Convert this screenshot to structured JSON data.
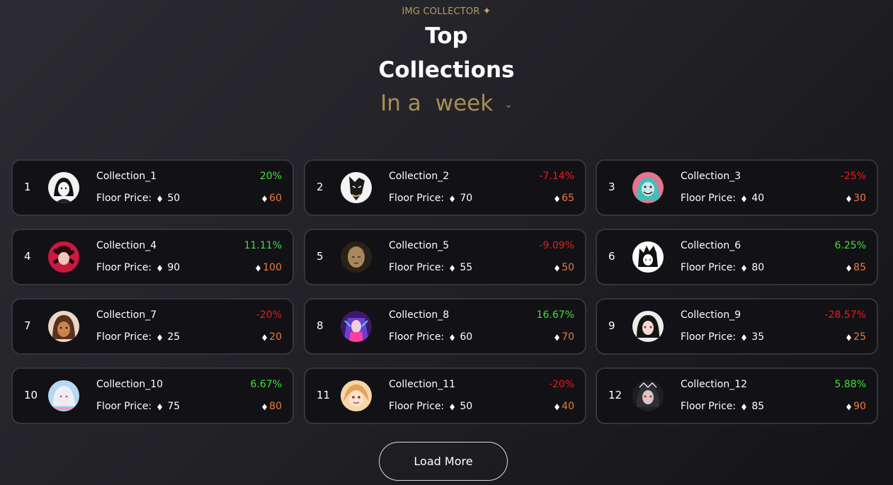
{
  "header": {
    "eyebrow": "IMG COLLECTOR",
    "eyebrow_icon": "sparkle-icon",
    "title_line1": "Top",
    "title_line2": "Collections",
    "period_prefix": "In a",
    "period_value": "week",
    "period_icon": "chevron-down-icon"
  },
  "labels": {
    "floor_price": "Floor Price:"
  },
  "colors": {
    "accent_gold": "#a88f56",
    "positive": "#3ee03a",
    "negative": "#ee1a1a",
    "current_price": "#f07a3c"
  },
  "collections": [
    {
      "rank": "1",
      "name": "Collection_1",
      "change": "20%",
      "direction": "up",
      "floor": "50",
      "current": "60"
    },
    {
      "rank": "2",
      "name": "Collection_2",
      "change": "-7.14%",
      "direction": "down",
      "floor": "70",
      "current": "65"
    },
    {
      "rank": "3",
      "name": "Collection_3",
      "change": "-25%",
      "direction": "down",
      "floor": "40",
      "current": "30"
    },
    {
      "rank": "4",
      "name": "Collection_4",
      "change": "11.11%",
      "direction": "up",
      "floor": "90",
      "current": "100"
    },
    {
      "rank": "5",
      "name": "Collection_5",
      "change": "-9.09%",
      "direction": "down",
      "floor": "55",
      "current": "50"
    },
    {
      "rank": "6",
      "name": "Collection_6",
      "change": "6.25%",
      "direction": "up",
      "floor": "80",
      "current": "85"
    },
    {
      "rank": "7",
      "name": "Collection_7",
      "change": "-20%",
      "direction": "down",
      "floor": "25",
      "current": "20"
    },
    {
      "rank": "8",
      "name": "Collection_8",
      "change": "16.67%",
      "direction": "up",
      "floor": "60",
      "current": "70"
    },
    {
      "rank": "9",
      "name": "Collection_9",
      "change": "-28.57%",
      "direction": "down",
      "floor": "35",
      "current": "25"
    },
    {
      "rank": "10",
      "name": "Collection_10",
      "change": "6.67%",
      "direction": "up",
      "floor": "75",
      "current": "80"
    },
    {
      "rank": "11",
      "name": "Collection_11",
      "change": "-20%",
      "direction": "down",
      "floor": "50",
      "current": "40"
    },
    {
      "rank": "12",
      "name": "Collection_12",
      "change": "5.88%",
      "direction": "up",
      "floor": "85",
      "current": "90"
    }
  ],
  "load_more_label": "Load More"
}
